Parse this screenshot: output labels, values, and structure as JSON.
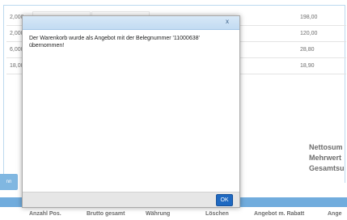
{
  "table": {
    "rows": [
      {
        "qty": "2,000",
        "price": "198,00"
      },
      {
        "qty": "2,000",
        "price": "120,00"
      },
      {
        "qty": "6,000",
        "price": "28,80"
      },
      {
        "qty": "18,00",
        "price": "18,90"
      }
    ]
  },
  "summary": {
    "net_label": "Nettosum",
    "vat_label": "Mehrwert",
    "total_label": "Gesamtsu"
  },
  "left_button": {
    "label": "nn"
  },
  "footer": {
    "columns": [
      "Anzahl Pos.",
      "Brutto gesamt",
      "Währung",
      "Löschen",
      "Angebot m. Rabatt",
      "Ange"
    ]
  },
  "dialog": {
    "close_label": "x",
    "message": "Der Warenkorb wurde als Angebot mit der Belegnummer '11000638' übernommen!",
    "ok_label": "OK"
  }
}
